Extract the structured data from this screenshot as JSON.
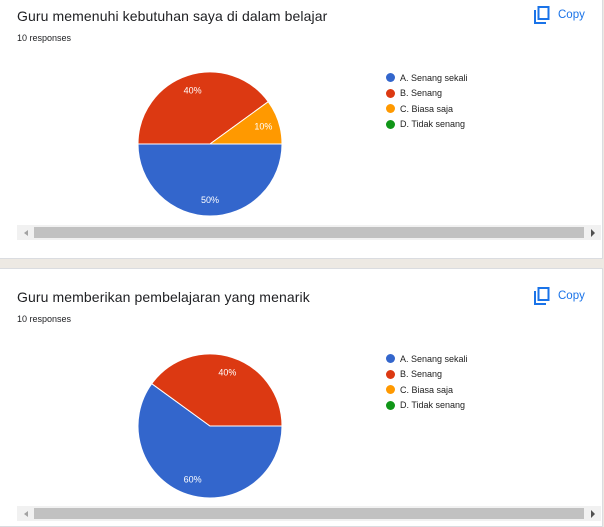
{
  "cards": [
    {
      "title": "Guru memenuhi kebutuhan saya di dalam belajar",
      "responses": "10 responses",
      "copy_label": "Copy"
    },
    {
      "title": "Guru memberikan pembelajaran yang menarik",
      "responses": "10 responses",
      "copy_label": "Copy"
    }
  ],
  "icons": {
    "copy": "copy-icon",
    "scroll_left": "arrow-left-icon",
    "scroll_right": "arrow-right-icon"
  },
  "colors": {
    "accent": "#1a73e8"
  },
  "chart_data": [
    {
      "type": "pie",
      "title": "Guru memenuhi kebutuhan saya di dalam belajar",
      "total_responses": 10,
      "categories": [
        "A. Senang sekali",
        "B. Senang",
        "C. Biasa saja",
        "D. Tidak senang"
      ],
      "values": [
        50,
        40,
        10,
        0
      ],
      "labels": [
        "50%",
        "40%",
        "10%",
        ""
      ],
      "colors": [
        "#3366cc",
        "#dc3912",
        "#ff9900",
        "#109618"
      ],
      "legend": "right"
    },
    {
      "type": "pie",
      "title": "Guru memberikan pembelajaran yang menarik",
      "total_responses": 10,
      "categories": [
        "A. Senang sekali",
        "B. Senang",
        "C. Biasa saja",
        "D. Tidak senang"
      ],
      "values": [
        60,
        40,
        0,
        0
      ],
      "labels": [
        "60%",
        "40%",
        "",
        ""
      ],
      "colors": [
        "#3366cc",
        "#dc3912",
        "#ff9900",
        "#109618"
      ],
      "legend": "right"
    }
  ]
}
